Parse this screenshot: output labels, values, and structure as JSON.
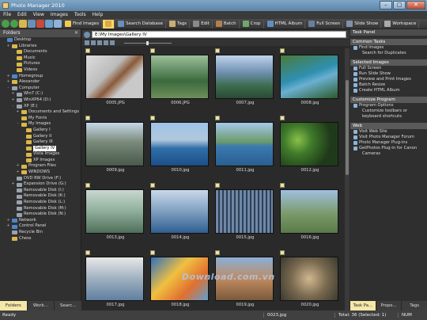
{
  "window": {
    "title": "Photo Manager 2010"
  },
  "menu": [
    "File",
    "Edit",
    "View",
    "Images",
    "Tools",
    "Help"
  ],
  "toolbar": [
    {
      "label": "Find Images",
      "color": "#f2c94c"
    },
    {
      "label": "",
      "color": "#d8a94a"
    },
    {
      "label": "Search Database",
      "color": "#6a8fb8"
    },
    {
      "label": "Tags",
      "color": "#c9b072"
    },
    {
      "label": "Edit",
      "color": "#8a8a8a"
    },
    {
      "label": "Batch",
      "color": "#b08050"
    },
    {
      "label": "Crop",
      "color": "#6fa86f"
    },
    {
      "label": "HTML Album",
      "color": "#5f8fc0"
    },
    {
      "label": "Full Screen",
      "color": "#6a7fa0"
    },
    {
      "label": "Slide Show",
      "color": "#8090a8"
    },
    {
      "label": "Workspace",
      "color": "#aaa"
    }
  ],
  "left_panel": {
    "title": "Folders",
    "tree": [
      {
        "label": "Desktop",
        "indent": 0,
        "exp": "",
        "icon": "blue"
      },
      {
        "label": "Libraries",
        "indent": 1,
        "exp": "+",
        "icon": "folder"
      },
      {
        "label": "Documents",
        "indent": 2,
        "exp": "",
        "icon": "folder"
      },
      {
        "label": "Music",
        "indent": 2,
        "exp": "",
        "icon": "folder"
      },
      {
        "label": "Pictures",
        "indent": 2,
        "exp": "",
        "icon": "folder"
      },
      {
        "label": "Videos",
        "indent": 2,
        "exp": "",
        "icon": "folder"
      },
      {
        "label": "Homegroup",
        "indent": 1,
        "exp": "+",
        "icon": "blue"
      },
      {
        "label": "Alexander",
        "indent": 1,
        "exp": "+",
        "icon": "folder"
      },
      {
        "label": "Computer",
        "indent": 1,
        "exp": "-",
        "icon": "drive"
      },
      {
        "label": "Win7 (C:)",
        "indent": 2,
        "exp": "+",
        "icon": "drive"
      },
      {
        "label": "WinXP64 (D:)",
        "indent": 2,
        "exp": "+",
        "icon": "drive"
      },
      {
        "label": "XP (E:)",
        "indent": 2,
        "exp": "-",
        "icon": "drive"
      },
      {
        "label": "Documents and Settings",
        "indent": 3,
        "exp": "+",
        "icon": "folder"
      },
      {
        "label": "My Fonts",
        "indent": 3,
        "exp": "",
        "icon": "folder"
      },
      {
        "label": "My Images",
        "indent": 3,
        "exp": "-",
        "icon": "folder"
      },
      {
        "label": "Gallery I",
        "indent": 4,
        "exp": "",
        "icon": "folder"
      },
      {
        "label": "Gallery II",
        "indent": 4,
        "exp": "",
        "icon": "folder"
      },
      {
        "label": "Gallery III",
        "indent": 4,
        "exp": "",
        "icon": "folder"
      },
      {
        "label": "Gallery IV",
        "indent": 4,
        "exp": "",
        "icon": "folder",
        "selected": true
      },
      {
        "label": "Vista Images",
        "indent": 4,
        "exp": "",
        "icon": "folder"
      },
      {
        "label": "XP Images",
        "indent": 4,
        "exp": "",
        "icon": "folder"
      },
      {
        "label": "Program Files",
        "indent": 3,
        "exp": "+",
        "icon": "folder"
      },
      {
        "label": "WINDOWS",
        "indent": 3,
        "exp": "+",
        "icon": "folder"
      },
      {
        "label": "DVD RW Drive (F:)",
        "indent": 2,
        "exp": "",
        "icon": "drive"
      },
      {
        "label": "Expansion Drive (G:)",
        "indent": 2,
        "exp": "+",
        "icon": "drive"
      },
      {
        "label": "Removable Disk (I:)",
        "indent": 2,
        "exp": "",
        "icon": "drive"
      },
      {
        "label": "Removable Disk (K:)",
        "indent": 2,
        "exp": "",
        "icon": "drive"
      },
      {
        "label": "Removable Disk (L:)",
        "indent": 2,
        "exp": "",
        "icon": "drive"
      },
      {
        "label": "Removable Disk (M:)",
        "indent": 2,
        "exp": "",
        "icon": "drive"
      },
      {
        "label": "Removable Disk (N:)",
        "indent": 2,
        "exp": "",
        "icon": "drive"
      },
      {
        "label": "Network",
        "indent": 1,
        "exp": "+",
        "icon": "blue"
      },
      {
        "label": "Control Panel",
        "indent": 1,
        "exp": "+",
        "icon": "blue"
      },
      {
        "label": "Recycle Bin",
        "indent": 1,
        "exp": "",
        "icon": "drive"
      },
      {
        "label": "Chess",
        "indent": 1,
        "exp": "",
        "icon": "folder"
      }
    ],
    "tabs": [
      "Folders",
      "Work...",
      "Searc..."
    ]
  },
  "address": {
    "path": "E:\\My Images\\Gallery IV"
  },
  "thumbnails": [
    {
      "caption": "0005.JPG",
      "bg": "linear-gradient(135deg,#ddd 0%,#bbb 40%,#8a5a3a 55%,#c9c9c9 70%)"
    },
    {
      "caption": "0006.JPG",
      "bg": "linear-gradient(180deg,#9bbf9a 0%,#3b6a3e 60%,#6e8f5a 100%)"
    },
    {
      "caption": "0007.jpg",
      "bg": "linear-gradient(180deg,#bfd4ea 0%,#6f8fb0 40%,#3d6d50 70%,#2b4a33 100%)"
    },
    {
      "caption": "0008.jpg",
      "bg": "linear-gradient(160deg,#4a7a3a 0%,#2f8fb0 45%,#6ab0d0 60%,#2d5a2a 100%)"
    },
    {
      "caption": "0009.jpg",
      "bg": "linear-gradient(180deg,#c7d8ea 0%,#7a8a7a 45%,#4a5a4a 100%)"
    },
    {
      "caption": "0010.jpg",
      "bg": "linear-gradient(180deg,#9fc3e8 0%,#b0c8dc 40%,#2f6fa8 60%,#1d4f88 100%)"
    },
    {
      "caption": "0011.jpg",
      "bg": "linear-gradient(180deg,#a6c8ea 0%,#6a9a6a 45%,#3a7ab0 55%,#2a5f90 100%)"
    },
    {
      "caption": "0012.jpg",
      "bg": "radial-gradient(circle at 30% 40%,#8ac04a 0%,#3f7a2a 30%,#1f3a1a 70%)"
    },
    {
      "caption": "0013.jpg",
      "bg": "linear-gradient(180deg,#c8d8d0 0%,#8fae9a 50%,#4f6f5a 100%)"
    },
    {
      "caption": "0014.jpg",
      "bg": "linear-gradient(180deg,#c9d8ea 0%,#7f9fc0 50%,#2f5f90 100%)"
    },
    {
      "caption": "0015.jpg",
      "bg": "repeating-linear-gradient(90deg,#6f88a8 0 3px,#2f3f55 3px 5px)"
    },
    {
      "caption": "0016.jpg",
      "bg": "linear-gradient(180deg,#9fbfe0 0%,#7a9a6a 55%,#5a7a4a 100%)"
    },
    {
      "caption": "0017.jpg",
      "bg": "linear-gradient(180deg,#e8e8e8 0%,#9fb0c0 50%,#5f7f9f 100%)"
    },
    {
      "caption": "0018.jpg",
      "bg": "linear-gradient(135deg,#2f6fc0 0%,#f0c040 40%,#e07030 70%,#5f9fd0 100%)"
    },
    {
      "caption": "0019.jpg",
      "bg": "linear-gradient(180deg,#8ab0d8 0%,#c08a60 50%,#7a5a3a 100%)"
    },
    {
      "caption": "0020.jpg",
      "bg": "radial-gradient(circle at 50% 50%,#d0b890 0%,#7a6a50 50%,#3a3a30 100%)"
    }
  ],
  "right_panel": {
    "sections": [
      {
        "title": "Task Panel",
        "items": []
      },
      {
        "title": "Common Tasks",
        "items": [
          {
            "label": "Find Images",
            "icon": true
          },
          {
            "label": "Search for Duplicates",
            "icon": false
          }
        ]
      },
      {
        "title": "Selected Images",
        "items": [
          {
            "label": "Full Screen",
            "icon": true
          },
          {
            "label": "Run Slide Show",
            "icon": true
          },
          {
            "label": "Preview and Print Images",
            "icon": true
          },
          {
            "label": "Batch Resize",
            "icon": true
          },
          {
            "label": "Create HTML Album",
            "icon": true
          }
        ]
      },
      {
        "title": "Customize Program",
        "items": [
          {
            "label": "Program Options",
            "icon": true
          },
          {
            "label": "Customize toolbars or",
            "icon": false
          },
          {
            "label": "keyboard shortcuts",
            "icon": false
          }
        ]
      },
      {
        "title": "Web",
        "items": [
          {
            "label": "Visit Web Site",
            "icon": true
          },
          {
            "label": "Visit Photo Manager Forum",
            "icon": true
          },
          {
            "label": "Photo Manager Plug-ins",
            "icon": true
          },
          {
            "label": "GetPhotos Plug-in for Canon",
            "icon": true
          },
          {
            "label": "Cameras",
            "icon": false
          }
        ]
      }
    ],
    "tabs": [
      "Task Pa...",
      "Prope...",
      "Tags"
    ]
  },
  "status": {
    "ready": "Ready",
    "file": "0023.jpg",
    "total": "Total: 36 (Selected: 1)",
    "num": "NUM"
  },
  "watermark": "Download.com.vn"
}
